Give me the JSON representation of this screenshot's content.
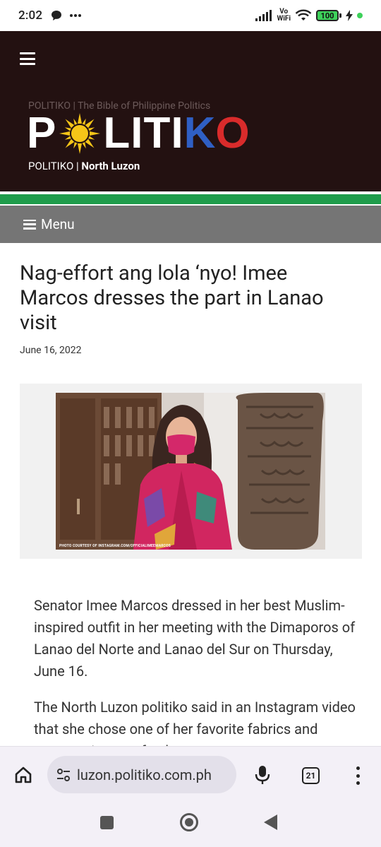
{
  "status_bar": {
    "time": "2:02",
    "network_label_top": "Vo",
    "network_label_bottom": "WiFi",
    "battery": "100"
  },
  "header": {
    "tagline": "POLITIKO | The Bible of Philippine Politics",
    "logo_letters": {
      "p": "P",
      "middle": "LITI",
      "k": "K",
      "o": "O"
    },
    "subline_site": "POLITIKO",
    "subline_separator": "|",
    "subline_section": "North Luzon"
  },
  "menu": {
    "label": "Menu"
  },
  "article": {
    "title": "Nag-effort ang lola ‘nyo! Imee Marcos dresses the part in Lanao visit",
    "date": "June 16, 2022",
    "photo_caption": "PHOTO COURTESY OF INSTAGRAM.COM/OFFICIALIMEEMARCOS",
    "paragraphs": [
      "Senator Imee Marcos dressed in her best Muslim-inspired outfit in her meeting with the Dimaporos of Lanao del Norte and Lanao del Sur on Thursday, June 16.",
      "The North Luzon politiko said in an Instagram video that she chose one of her favorite fabrics and accessories to refresh..."
    ]
  },
  "browser": {
    "url": "luzon.politiko.com.ph",
    "tab_count": "21"
  },
  "colors": {
    "header_bg": "#231111",
    "green_stripe": "#1f9c4b",
    "menu_bg": "#757575",
    "logo_blue": "#2f5fc4",
    "logo_red": "#d92b2b",
    "sun_yellow": "#f5c518"
  }
}
